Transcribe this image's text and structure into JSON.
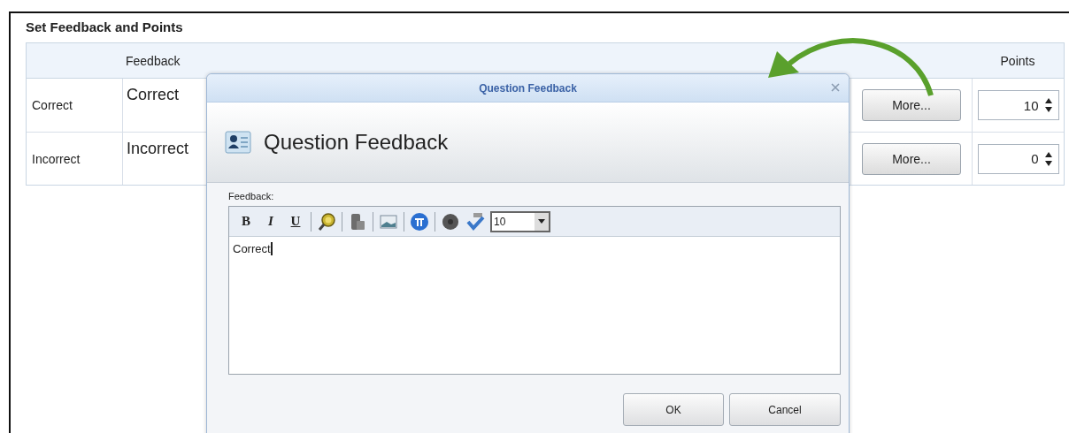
{
  "panel": {
    "title": "Set Feedback and Points"
  },
  "table": {
    "headers": {
      "feedback": "Feedback",
      "points": "Points"
    },
    "rows": [
      {
        "label": "Correct",
        "feedback": "Correct",
        "button": "More...",
        "points": "10"
      },
      {
        "label": "Incorrect",
        "feedback": "Incorrect",
        "button": "More...",
        "points": "0"
      }
    ]
  },
  "dialog": {
    "title": "Question Feedback",
    "heading": "Question Feedback",
    "field_label": "Feedback:",
    "toolbar": [
      {
        "kind": "bold",
        "label": "B"
      },
      {
        "kind": "italic",
        "label": "I"
      },
      {
        "kind": "underline",
        "label": "U"
      },
      {
        "kind": "separator"
      },
      {
        "kind": "find"
      },
      {
        "kind": "separator"
      },
      {
        "kind": "paste"
      },
      {
        "kind": "separator"
      },
      {
        "kind": "image"
      },
      {
        "kind": "separator"
      },
      {
        "kind": "equation"
      },
      {
        "kind": "separator"
      },
      {
        "kind": "record"
      },
      {
        "kind": "spellcheck"
      }
    ],
    "font_size": "10",
    "value": "Correct",
    "buttons": [
      "OK",
      "Cancel"
    ]
  }
}
